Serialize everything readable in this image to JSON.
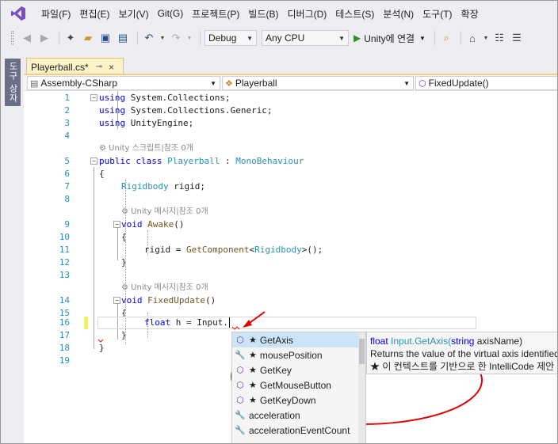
{
  "menubar": {
    "items": [
      "파일(F)",
      "편집(E)",
      "보기(V)",
      "Git(G)",
      "프로젝트(P)",
      "빌드(B)",
      "디버그(D)",
      "테스트(S)",
      "분석(N)",
      "도구(T)",
      "확장"
    ]
  },
  "toolbar": {
    "config": "Debug",
    "platform": "Any CPU",
    "run_label": "Unity에 연결"
  },
  "sidedock": {
    "tab_label": "도구 상자"
  },
  "tabs": {
    "active_tab": "Playerball.cs*",
    "pin_glyph": "⊸",
    "close_glyph": "×"
  },
  "navbar": {
    "project": "Assembly-CSharp",
    "class": "Playerball",
    "member": "FixedUpdate()"
  },
  "editor": {
    "line_numbers": [
      "1",
      "2",
      "3",
      "4",
      "5",
      "6",
      "7",
      "8",
      "9",
      "10",
      "11",
      "12",
      "13",
      "14",
      "15",
      "16",
      "17",
      "18",
      "19"
    ],
    "using1_kw": "using",
    "using1_ns": " System.Collections;",
    "using2_kw": "using",
    "using2_ns": " System.Collections.Generic;",
    "using3_kw": "using",
    "using3_ns": " UnityEngine;",
    "lens_class": "Unity 스크립트|참조 0개",
    "line5_public": "public",
    "line5_class": " class ",
    "line5_name": "Playerball",
    "line5_colon": " : ",
    "line5_base": "MonoBehaviour",
    "line6": "{",
    "line7_type": "Rigidbody",
    "line7_rest": " rigid;",
    "lens_awake": "Unity 메시지|참조 0개",
    "line9_void": "void",
    "line9_name": " Awake",
    "line9_rest": "()",
    "line10": "{",
    "line11_var": "rigid = ",
    "line11_fn": "GetComponent",
    "line11_lt": "<",
    "line11_type": "Rigidbody",
    "line11_rest": ">();",
    "line12": "}",
    "lens_fixed": "Unity 메시지|참조 0개",
    "line14_void": "void",
    "line14_name": " FixedUpdate",
    "line14_rest": "()",
    "line15": "{",
    "line16_float": "float",
    "line16_rest": " h = Input.",
    "line17": "}",
    "line18": "}"
  },
  "completion": {
    "items": [
      {
        "label": "GetAxis",
        "icon": "method-icon",
        "starred": true
      },
      {
        "label": "mousePosition",
        "icon": "property-icon",
        "starred": true
      },
      {
        "label": "GetKey",
        "icon": "method-icon",
        "starred": true
      },
      {
        "label": "GetMouseButton",
        "icon": "method-icon",
        "starred": true
      },
      {
        "label": "GetKeyDown",
        "icon": "method-icon",
        "starred": true
      },
      {
        "label": "acceleration",
        "icon": "property-icon",
        "starred": false
      },
      {
        "label": "accelerationEventCount",
        "icon": "property-icon",
        "starred": false
      }
    ]
  },
  "tooltip": {
    "sig_kw": "float",
    "sig_type": "Input",
    "sig_method": ".GetAxis(",
    "sig_param_kw": "string",
    "sig_param": " axisName)",
    "description": "Returns the value of the virtual axis identified",
    "intellicode": "★  이 컨텍스트를 기반으로 한 IntelliCode 제안"
  }
}
